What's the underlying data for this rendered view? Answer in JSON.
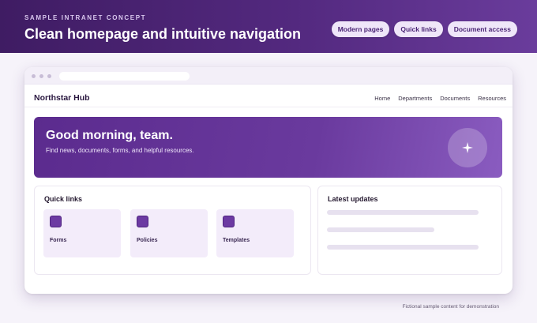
{
  "banner": {
    "eyebrow": "SAMPLE INTRANET CONCEPT",
    "headline": "Clean homepage and intuitive navigation",
    "pills": [
      "Modern pages",
      "Quick links",
      "Document access"
    ]
  },
  "app": {
    "brand": "Northstar Hub",
    "nav": [
      "Home",
      "Departments",
      "Documents",
      "Resources"
    ]
  },
  "hero": {
    "title": "Good morning, team.",
    "subtitle": "Find news, documents, forms, and helpful resources.",
    "icon": "sparkle-icon"
  },
  "quick_links": {
    "title": "Quick links",
    "items": [
      {
        "label": "Forms",
        "icon": "forms-icon"
      },
      {
        "label": "Policies",
        "icon": "policies-icon"
      },
      {
        "label": "Templates",
        "icon": "templates-icon"
      }
    ]
  },
  "latest_updates": {
    "title": "Latest updates"
  },
  "footnote": "Fictional sample content for demonstration",
  "colors": {
    "banner": "#4a2275",
    "accent": "#6c3aa2",
    "pill_bg": "#efe6f9",
    "tile_bg": "#f3ecfa"
  }
}
